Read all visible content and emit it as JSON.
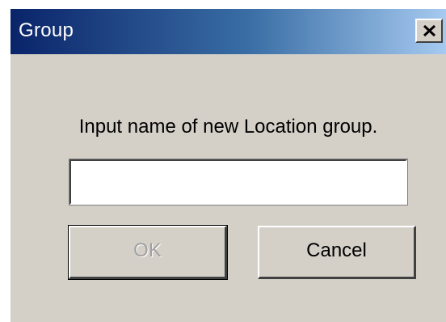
{
  "window": {
    "title": "Group"
  },
  "dialog": {
    "prompt": "Input name of new Location group.",
    "name_input": {
      "value": "",
      "placeholder": ""
    },
    "ok_label": "OK",
    "cancel_label": "Cancel"
  },
  "icons": {
    "close": "close-icon"
  },
  "colors": {
    "titlebar_start": "#0a246a",
    "titlebar_end": "#a6caf0",
    "face": "#d4d0c8",
    "disabled_text": "#a0a0a0"
  }
}
